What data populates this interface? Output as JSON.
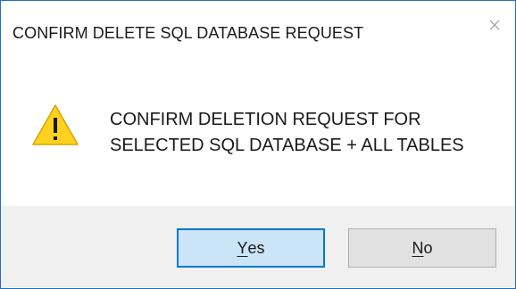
{
  "dialog": {
    "title": "CONFIRM DELETE SQL DATABASE REQUEST",
    "close_icon": "close-icon",
    "warning_icon": "warning-icon",
    "message_line1": "CONFIRM DELETION REQUEST FOR",
    "message_line2": "SELECTED SQL DATABASE + ALL TABLES",
    "buttons": {
      "yes": {
        "mnemonic": "Y",
        "rest": "es"
      },
      "no": {
        "mnemonic": "N",
        "rest": "o"
      }
    }
  },
  "colors": {
    "window_border": "#1f6fbf",
    "footer_background": "#f0f0f0",
    "default_button_fill": "#cce4f7",
    "default_button_border": "#0078d7",
    "button_fill": "#e1e1e1",
    "warning_yellow": "#ffd21f"
  }
}
